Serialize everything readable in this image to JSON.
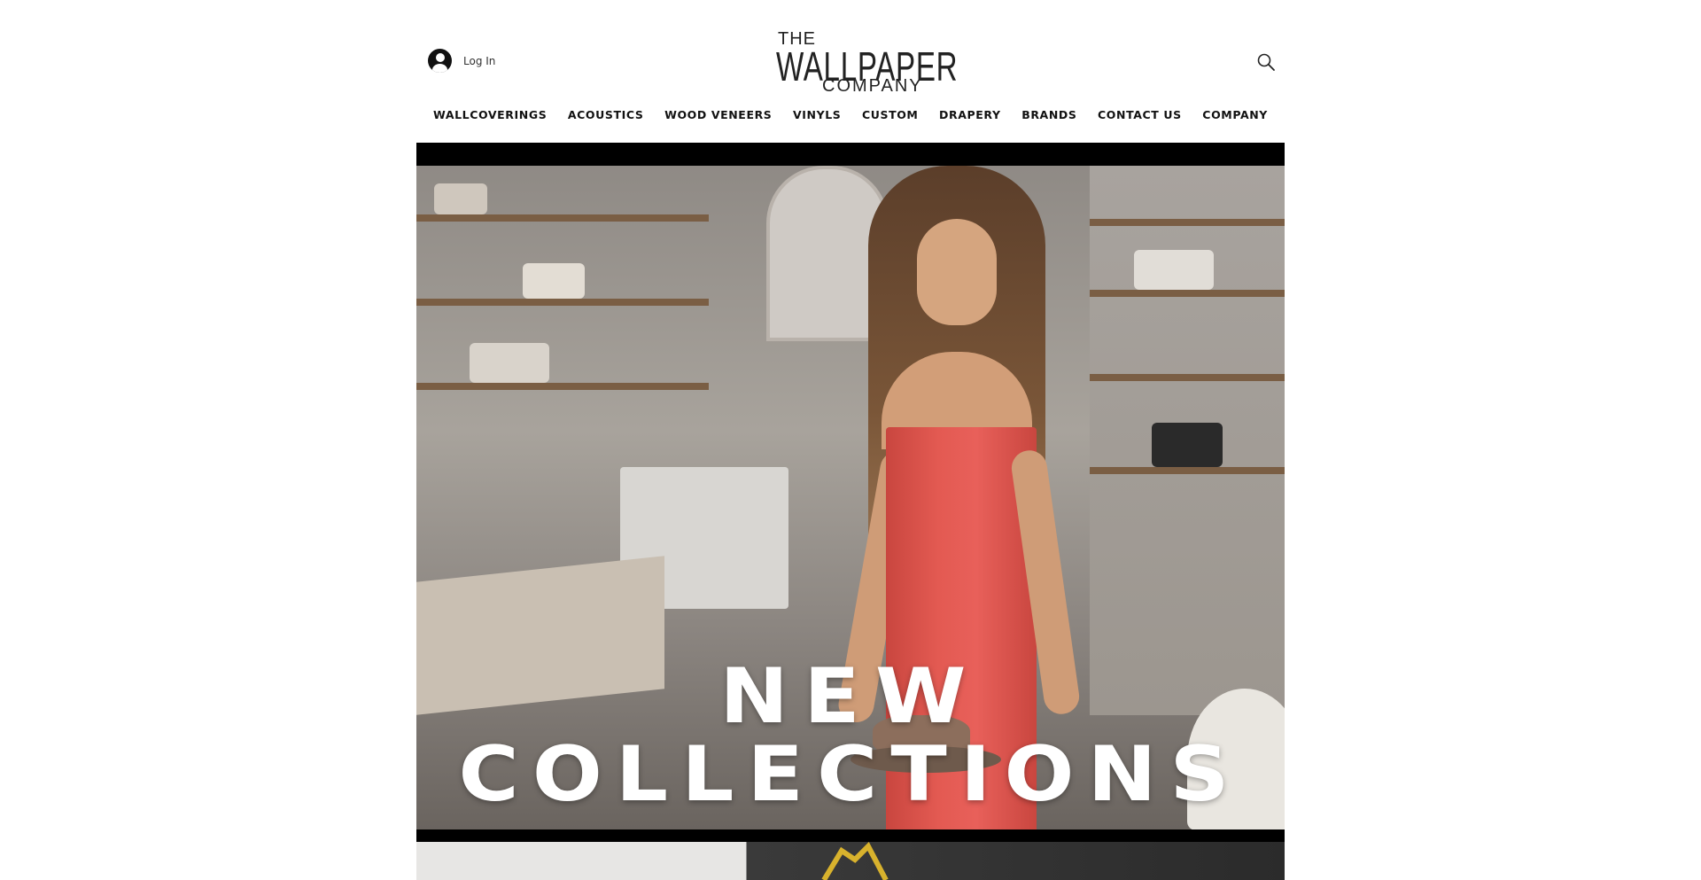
{
  "header": {
    "login_label": "Log In",
    "logo": {
      "the": "THE",
      "main": "WALLPAPER",
      "company": "COMPANY"
    }
  },
  "nav": {
    "items": [
      {
        "label": "WALLCOVERINGS"
      },
      {
        "label": "ACOUSTICS"
      },
      {
        "label": "WOOD VENEERS"
      },
      {
        "label": "VINYLS"
      },
      {
        "label": "CUSTOM"
      },
      {
        "label": "DRAPERY"
      },
      {
        "label": "BRANDS"
      },
      {
        "label": "CONTACT US"
      },
      {
        "label": "COMPANY"
      }
    ]
  },
  "hero": {
    "headline_line1": "NEW",
    "headline_line2": "COLLECTIONS"
  },
  "icons": {
    "user": "user-avatar-icon",
    "search": "search-icon"
  }
}
